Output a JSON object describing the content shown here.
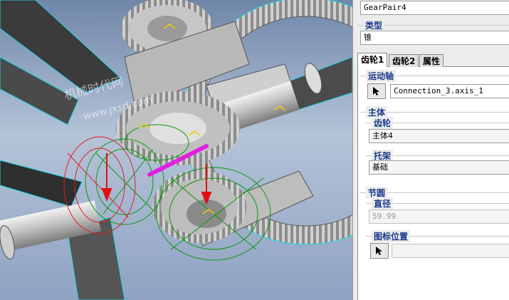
{
  "name_field": {
    "value": "GearPair4"
  },
  "type_group": {
    "label": "类型",
    "value": "锥"
  },
  "tabs": [
    {
      "label": "齿轮1",
      "active": true
    },
    {
      "label": "齿轮2",
      "active": false
    },
    {
      "label": "属性",
      "active": false
    }
  ],
  "motion_axis": {
    "label": "运动轴",
    "value": "Connection_3.axis_1"
  },
  "body_group": {
    "label": "主体",
    "gear": {
      "label": "齿轮",
      "value": "主体4"
    },
    "carrier": {
      "label": "托架",
      "value": "基础"
    }
  },
  "pitch_circle": {
    "label": "节圆",
    "diameter_label": "直径",
    "diameter_value": "59.99"
  },
  "icon_position": {
    "label": "图标位置",
    "value": ""
  },
  "watermark": {
    "line1": "机械时代网",
    "line2": "www.jxsd.com"
  },
  "icons": {
    "pick": "cursor-arrow-icon"
  },
  "colors": {
    "viewport_bg": "#9cb0cc",
    "group_label": "#1a3a8a",
    "gear_gray": "#c9c9c9",
    "cyan_edge": "#21d6e0"
  }
}
